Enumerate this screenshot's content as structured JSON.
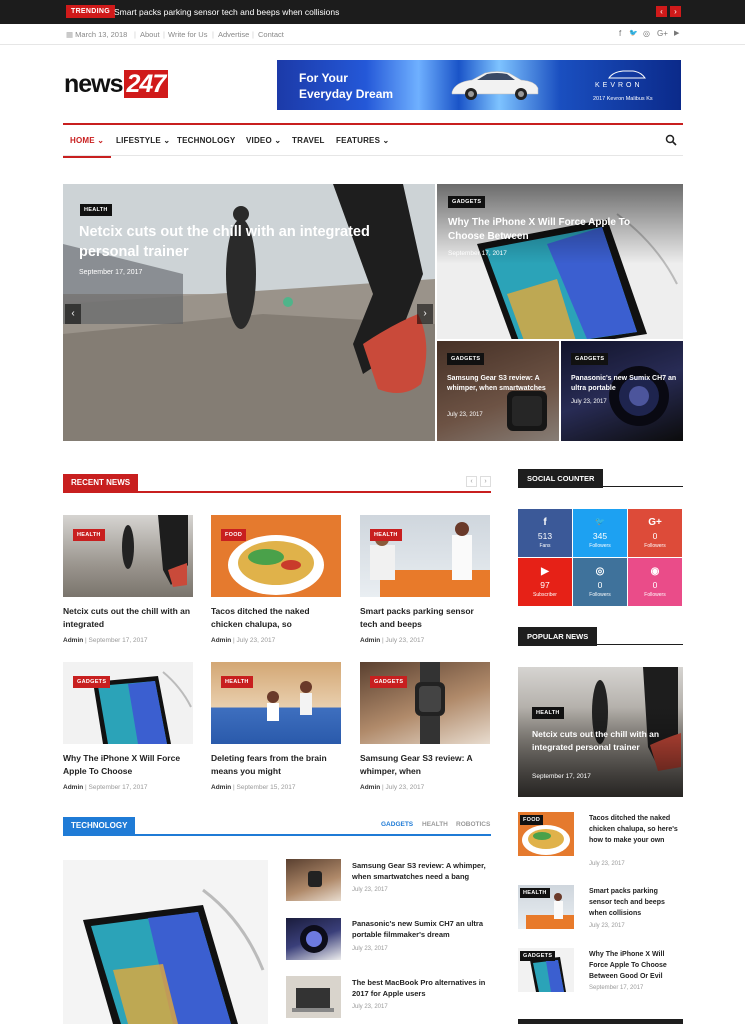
{
  "topbar": {
    "trending_label": "TRENDING",
    "trending_text": "Smart packs parking sensor tech and beeps when collisions",
    "prev": "‹",
    "next": "›"
  },
  "infobar": {
    "date": "March 13, 2018",
    "links": [
      "About",
      "Write for Us",
      "Advertise",
      "Contact"
    ],
    "social": [
      "f",
      "🐦",
      "◎",
      "G+",
      "▶"
    ]
  },
  "logo": {
    "text": "news",
    "num": "247"
  },
  "banner": {
    "line1": "For Your",
    "line2": "Everyday Dream",
    "brand": "KEVRON",
    "model": "2017 Kevron Malibus Ks"
  },
  "nav": {
    "items": [
      "HOME ⌄",
      "LIFESTYLE ⌄",
      "TECHNOLOGY",
      "VIDEO ⌄",
      "TRAVEL",
      "FEATURES ⌄"
    ]
  },
  "hero": {
    "main": {
      "cat": "HEALTH",
      "title": "Netcix cuts out the chill with an integrated personal trainer",
      "date": "September 17, 2017"
    },
    "right_top": {
      "cat": "GADGETS",
      "title": "Why The iPhone X Will Force Apple To Choose Between",
      "date": "September 17, 2017"
    },
    "small1": {
      "cat": "GADGETS",
      "title": "Samsung Gear S3 review: A whimper, when smartwatches",
      "date": "July 23, 2017"
    },
    "small2": {
      "cat": "GADGETS",
      "title": "Panasonic's new Sumix CH7 an ultra portable",
      "date": "July 23, 2017"
    }
  },
  "recent": {
    "label": "RECENT NEWS",
    "cards": [
      {
        "cat": "HEALTH",
        "title": "Netcix cuts out the chill with an integrated",
        "author": "Admin",
        "date": "September 17, 2017"
      },
      {
        "cat": "FOOD",
        "title": "Tacos ditched the naked chicken chalupa, so",
        "author": "Admin",
        "date": "July 23, 2017"
      },
      {
        "cat": "HEALTH",
        "title": "Smart packs parking sensor tech and beeps",
        "author": "Admin",
        "date": "July 23, 2017"
      },
      {
        "cat": "GADGETS",
        "title": "Why The iPhone X Will Force Apple To Choose",
        "author": "Admin",
        "date": "September 17, 2017"
      },
      {
        "cat": "HEALTH",
        "title": "Deleting fears from the brain means you might",
        "author": "Admin",
        "date": "September 15, 2017"
      },
      {
        "cat": "GADGETS",
        "title": "Samsung Gear S3 review: A whimper, when",
        "author": "Admin",
        "date": "July 23, 2017"
      }
    ]
  },
  "technology": {
    "label": "TECHNOLOGY",
    "tabs": [
      "GADGETS",
      "HEALTH",
      "ROBOTICS"
    ],
    "list": [
      {
        "title": "Samsung Gear S3 review: A whimper, when smartwatches need a bang",
        "date": "July 23, 2017"
      },
      {
        "title": "Panasonic's new Sumix CH7 an ultra portable filmmaker's dream",
        "date": "July 23, 2017"
      },
      {
        "title": "The best MacBook Pro alternatives in 2017 for Apple users",
        "date": "July 23, 2017"
      }
    ]
  },
  "social_counter": {
    "label": "SOCIAL COUNTER",
    "cells": [
      {
        "icon": "f",
        "count": "513",
        "label": "Fans",
        "color": "#3b5998"
      },
      {
        "icon": "🐦",
        "count": "345",
        "label": "Followers",
        "color": "#1da1f2"
      },
      {
        "icon": "G+",
        "count": "0",
        "label": "Followers",
        "color": "#dd4b39"
      },
      {
        "icon": "▶",
        "count": "97",
        "label": "Subscriber",
        "color": "#e62117"
      },
      {
        "icon": "◎",
        "count": "0",
        "label": "Followers",
        "color": "#3f729b"
      },
      {
        "icon": "◉",
        "count": "0",
        "label": "Followers",
        "color": "#ea4c89"
      }
    ]
  },
  "popular": {
    "label": "POPULAR NEWS",
    "big": {
      "cat": "HEALTH",
      "title": "Netcix cuts out the chill with an integrated personal trainer",
      "date": "September 17, 2017"
    },
    "items": [
      {
        "cat": "FOOD",
        "title": "Tacos ditched the naked chicken chalupa, so here's how to make your own",
        "date": "July 23, 2017"
      },
      {
        "cat": "HEALTH",
        "title": "Smart packs parking sensor tech and beeps when collisions",
        "date": "July 23, 2017"
      },
      {
        "cat": "GADGETS",
        "title": "Why The iPhone X Will Force Apple To Choose Between Good Or Evil",
        "date": "September 17, 2017"
      }
    ]
  },
  "colors": {
    "accent": "#c81f1f",
    "tech_accent": "#1f7bd6",
    "dark": "#1e1e1e"
  }
}
